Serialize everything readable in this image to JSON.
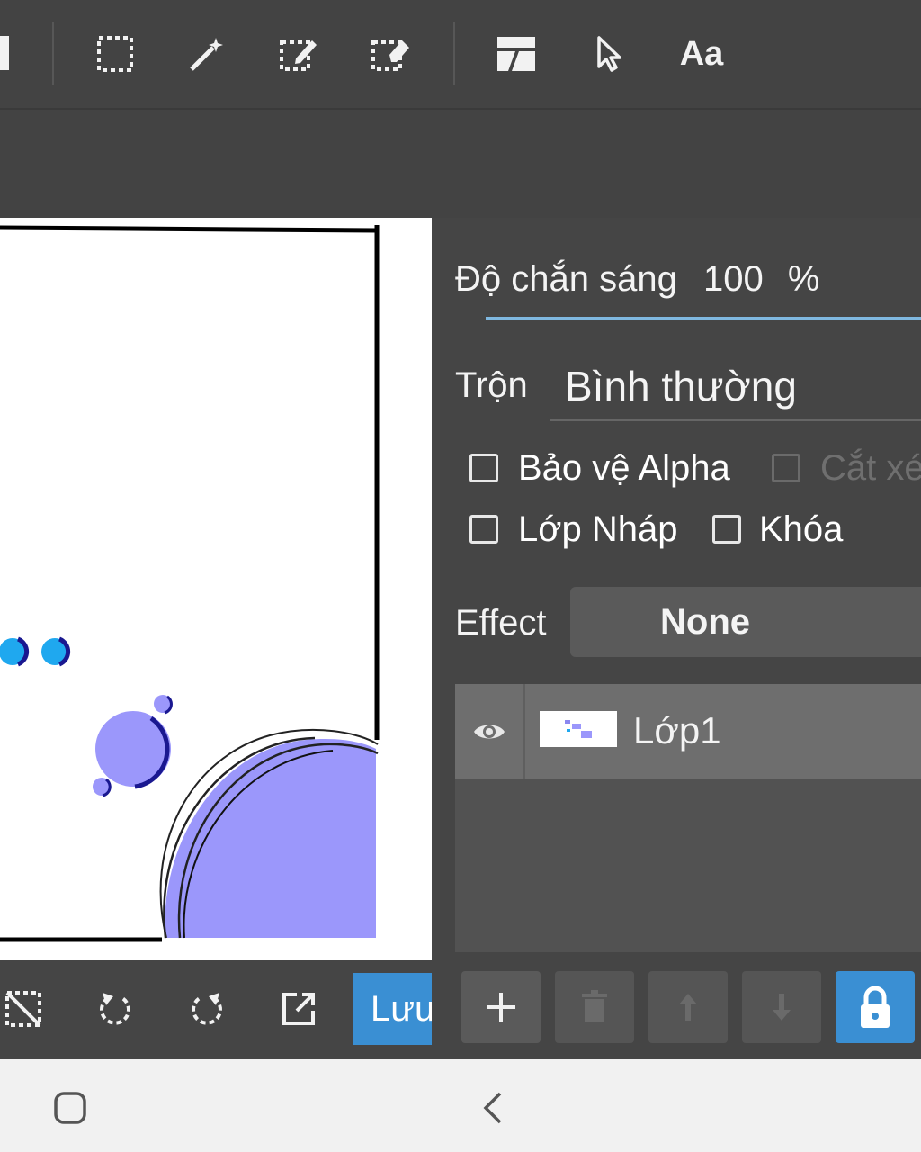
{
  "toolbar": {
    "tools": [
      {
        "name": "select-rect",
        "icon": "marquee-select-icon"
      },
      {
        "name": "magic-wand",
        "icon": "magic-wand-icon"
      },
      {
        "name": "select-pen",
        "icon": "selection-pen-icon"
      },
      {
        "name": "select-eraser",
        "icon": "selection-eraser-icon"
      },
      {
        "name": "frame-divider",
        "icon": "frame-divider-icon"
      },
      {
        "name": "operation",
        "icon": "pointer-icon"
      },
      {
        "name": "text",
        "icon": "text-tool-icon"
      }
    ],
    "text_tool_label": "Aa"
  },
  "layer_panel": {
    "opacity_label": "Độ chắn sáng",
    "opacity_value": "100",
    "opacity_unit": "%",
    "blend_label": "Trộn",
    "blend_value": "Bình thường",
    "checkboxes": {
      "alpha_protect": "Bảo vệ Alpha",
      "clipping": "Cắt xé",
      "draft_layer": "Lớp Nháp",
      "lock": "Khóa"
    },
    "effect_label": "Effect",
    "effect_value": "None",
    "layers": [
      {
        "name": "Lớp1",
        "visible": true
      }
    ]
  },
  "canvas_bar": {
    "save_label": "Lưu"
  },
  "colors": {
    "accent": "#3a8fd3",
    "toolbar_bg": "#434343",
    "panel_bg": "#454545",
    "bubble_fill": "#9b97fb",
    "dot_blue": "#1fa8ef",
    "dot_dark": "#1a1890"
  }
}
